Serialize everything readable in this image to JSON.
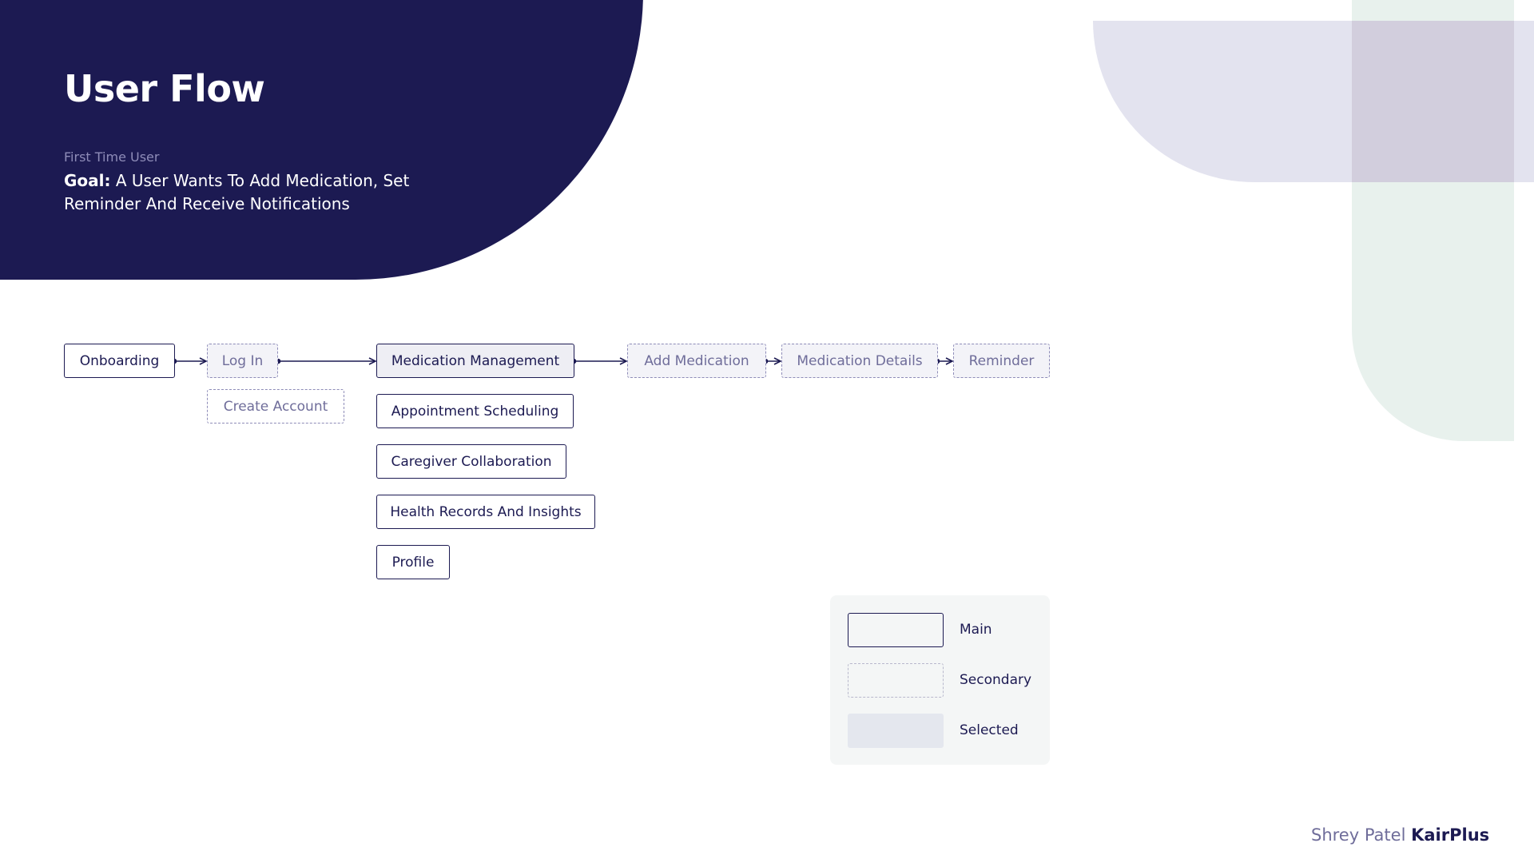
{
  "header": {
    "title": "User Flow",
    "subtitle": "First Time User",
    "goal_label": "Goal:",
    "goal_text": "A User Wants To Add Medication, Set Reminder And Receive Notifications"
  },
  "flow": {
    "onboarding": "Onboarding",
    "log_in": "Log In",
    "create_account": "Create Account",
    "medication_management": "Medication Management",
    "appointment_scheduling": "Appointment Scheduling",
    "caregiver_collaboration": "Caregiver Collaboration",
    "health_records": "Health Records And Insights",
    "profile": "Profile",
    "add_medication": "Add Medication",
    "medication_details": "Medication Details",
    "reminder": "Reminder"
  },
  "legend": {
    "main": "Main",
    "secondary": "Secondary",
    "selected": "Selected"
  },
  "footer": {
    "author": "Shrey Patel",
    "brand": "KairPlus"
  },
  "colors": {
    "navy": "#1c1a52",
    "muted_purple": "#8e8cb8",
    "lavender": "#e3e3ef",
    "mint": "#e8f1ed",
    "legend_bg": "#f4f6f6"
  }
}
